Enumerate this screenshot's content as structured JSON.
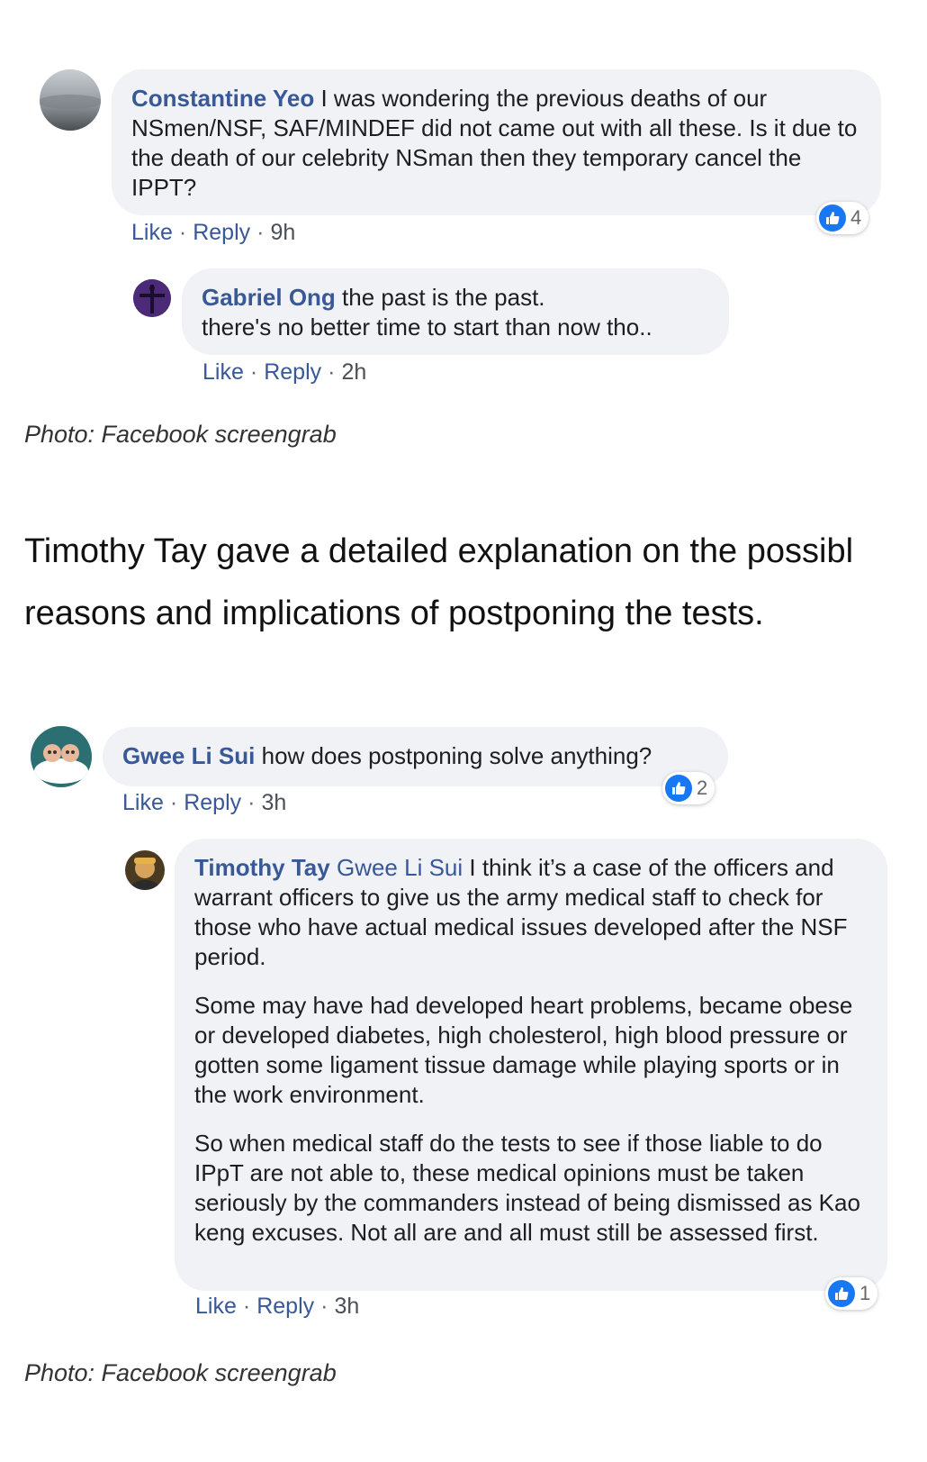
{
  "comments": [
    {
      "author": "Constantine Yeo",
      "text": "I was wondering the previous deaths of our NSmen/NSF, SAF/MINDEF did not came out with all these. Is it due to the death of our celebrity NSman then they temporary cancel the IPPT?",
      "like": "Like",
      "reply": "Reply",
      "time": "9h",
      "reaction_count": "4"
    },
    {
      "author": "Gabriel Ong",
      "text_line1": "the past is the past.",
      "text_line2": "there's no better time to start than now tho..",
      "like": "Like",
      "reply": "Reply",
      "time": "2h"
    },
    {
      "author": "Gwee Li Sui",
      "text": "how does postponing solve anything?",
      "like": "Like",
      "reply": "Reply",
      "time": "3h",
      "reaction_count": "2"
    },
    {
      "author": "Timothy Tay",
      "mention": "Gwee Li Sui",
      "paragraph1": "I think it’s a case of the officers and warrant officers to give us the army medical staff to check for those who have actual medical issues developed after the NSF period.",
      "paragraph2": "Some may have had developed heart problems, became obese or developed diabetes, high cholesterol, high blood pressure or gotten some ligament tissue damage while playing sports or in the work environment.",
      "paragraph3": "So when medical staff do the tests to see if those liable to do IPpT are not able to, these medical opinions must be taken seriously by the commanders instead of being dismissed as Kao keng excuses. Not all are and all must still be assessed first.",
      "like": "Like",
      "reply": "Reply",
      "time": "3h",
      "reaction_count": "1"
    }
  ],
  "captions": {
    "first": "Photo: Facebook screengrab",
    "second": "Photo: Facebook screengrab"
  },
  "article": {
    "line1": "Timothy Tay gave a detailed explanation on the possibl",
    "line2": "reasons and implications of postponing the tests."
  },
  "colors": {
    "name_link": "#385898",
    "bubble_bg": "#f0f2f5",
    "like_blue": "#1877f2"
  },
  "icons": [
    "like-thumb-icon",
    "avatar-photo"
  ]
}
